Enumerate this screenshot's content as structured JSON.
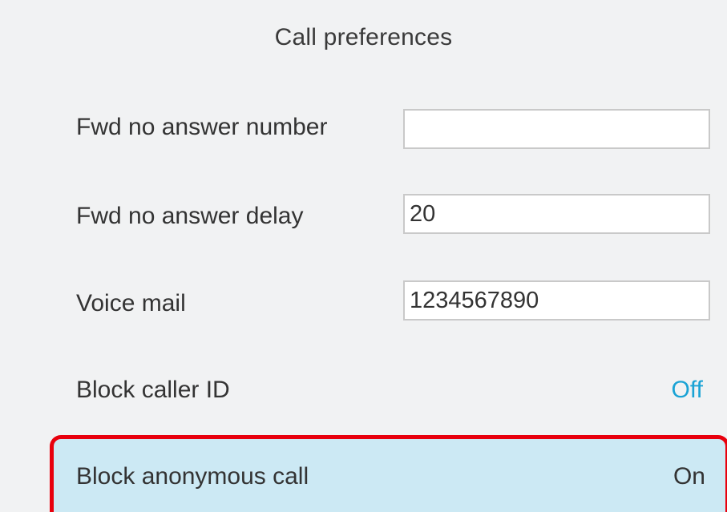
{
  "header": {
    "title": "Call preferences"
  },
  "settings": {
    "fwd_no_answer_number": {
      "label": "Fwd no answer number",
      "value": ""
    },
    "fwd_no_answer_delay": {
      "label": "Fwd no answer delay",
      "value": "20"
    },
    "voice_mail": {
      "label": "Voice mail",
      "value": "1234567890"
    },
    "block_caller_id": {
      "label": "Block caller ID",
      "value": "Off"
    },
    "block_anonymous_call": {
      "label": "Block anonymous call",
      "value": "On",
      "selected": true
    }
  },
  "colors": {
    "background": "#f1f2f3",
    "accent_blue": "#1aa3d5",
    "selected_row_fill": "#cce9f4",
    "highlight_border": "#e8000d"
  }
}
